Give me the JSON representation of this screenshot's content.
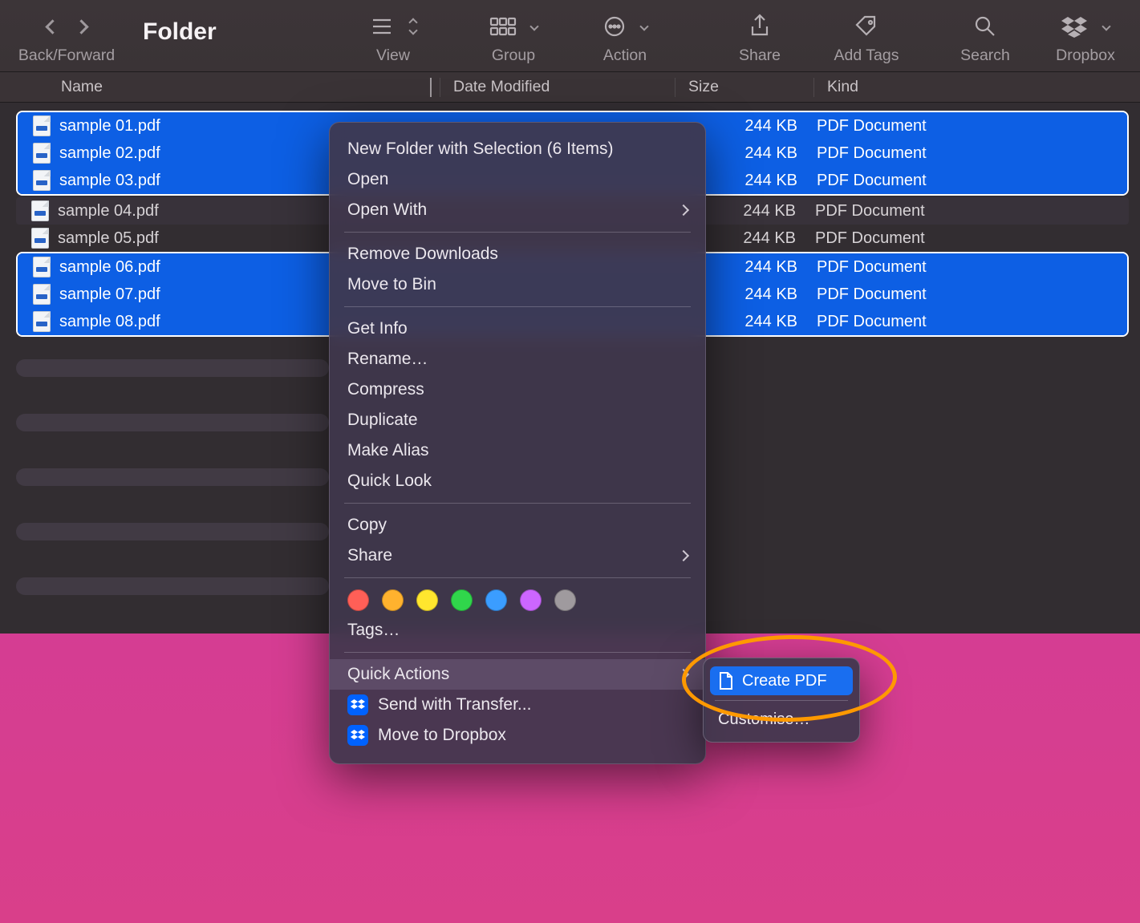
{
  "window": {
    "title": "Folder"
  },
  "toolbar": {
    "back_forward_label": "Back/Forward",
    "view_label": "View",
    "group_label": "Group",
    "action_label": "Action",
    "share_label": "Share",
    "add_tags_label": "Add Tags",
    "search_label": "Search",
    "dropbox_label": "Dropbox"
  },
  "columns": {
    "name": "Name",
    "date": "Date Modified",
    "size": "Size",
    "kind": "Kind"
  },
  "files": [
    {
      "name": "sample 01.pdf",
      "size": "244 KB",
      "kind": "PDF Document",
      "selected": true
    },
    {
      "name": "sample 02.pdf",
      "size": "244 KB",
      "kind": "PDF Document",
      "selected": true
    },
    {
      "name": "sample 03.pdf",
      "size": "244 KB",
      "kind": "PDF Document",
      "selected": true
    },
    {
      "name": "sample 04.pdf",
      "size": "244 KB",
      "kind": "PDF Document",
      "selected": false
    },
    {
      "name": "sample 05.pdf",
      "size": "244 KB",
      "kind": "PDF Document",
      "selected": false
    },
    {
      "name": "sample 06.pdf",
      "size": "244 KB",
      "kind": "PDF Document",
      "selected": true
    },
    {
      "name": "sample 07.pdf",
      "size": "244 KB",
      "kind": "PDF Document",
      "selected": true
    },
    {
      "name": "sample 08.pdf",
      "size": "244 KB",
      "kind": "PDF Document",
      "selected": true
    }
  ],
  "context_menu": {
    "new_folder": "New Folder with Selection (6 Items)",
    "open": "Open",
    "open_with": "Open With",
    "remove_downloads": "Remove Downloads",
    "move_to_bin": "Move to Bin",
    "get_info": "Get Info",
    "rename": "Rename…",
    "compress": "Compress",
    "duplicate": "Duplicate",
    "make_alias": "Make Alias",
    "quick_look": "Quick Look",
    "copy": "Copy",
    "share": "Share",
    "tags": "Tags…",
    "quick_actions": "Quick Actions",
    "send_transfer": "Send with Transfer...",
    "move_dropbox": "Move to Dropbox",
    "tag_colors": [
      "#ff5f57",
      "#ffb22e",
      "#ffe62e",
      "#30d64b",
      "#3b9dff",
      "#cc66ff",
      "#9f9a9e"
    ]
  },
  "submenu": {
    "create_pdf": "Create PDF",
    "customise": "Customise…"
  }
}
